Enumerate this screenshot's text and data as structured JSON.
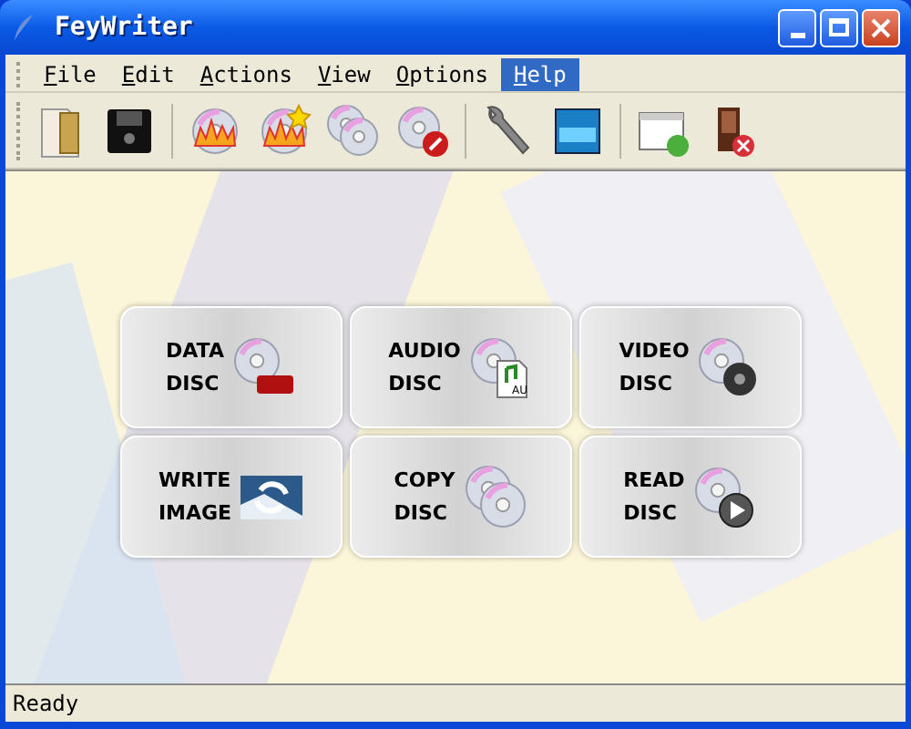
{
  "window": {
    "title": "FeyWriter"
  },
  "menu": [
    {
      "label": "File",
      "selected": false
    },
    {
      "label": "Edit",
      "selected": false
    },
    {
      "label": "Actions",
      "selected": false
    },
    {
      "label": "View",
      "selected": false
    },
    {
      "label": "Options",
      "selected": false
    },
    {
      "label": "Help",
      "selected": true
    }
  ],
  "cards": [
    {
      "kind": "data",
      "lines": [
        "DATA",
        "DISC"
      ]
    },
    {
      "kind": "audio",
      "lines": [
        "AUDIO",
        "DISC"
      ],
      "icon_text": "AU"
    },
    {
      "kind": "video",
      "lines": [
        "VIDEO",
        "DISC"
      ]
    },
    {
      "kind": "image",
      "lines": [
        "WRITE",
        "IMAGE"
      ]
    },
    {
      "kind": "copy",
      "lines": [
        "COPY",
        "DISC"
      ]
    },
    {
      "kind": "read",
      "lines": [
        "READ",
        "DISC"
      ]
    }
  ],
  "status_bar": {
    "text": "Ready"
  }
}
